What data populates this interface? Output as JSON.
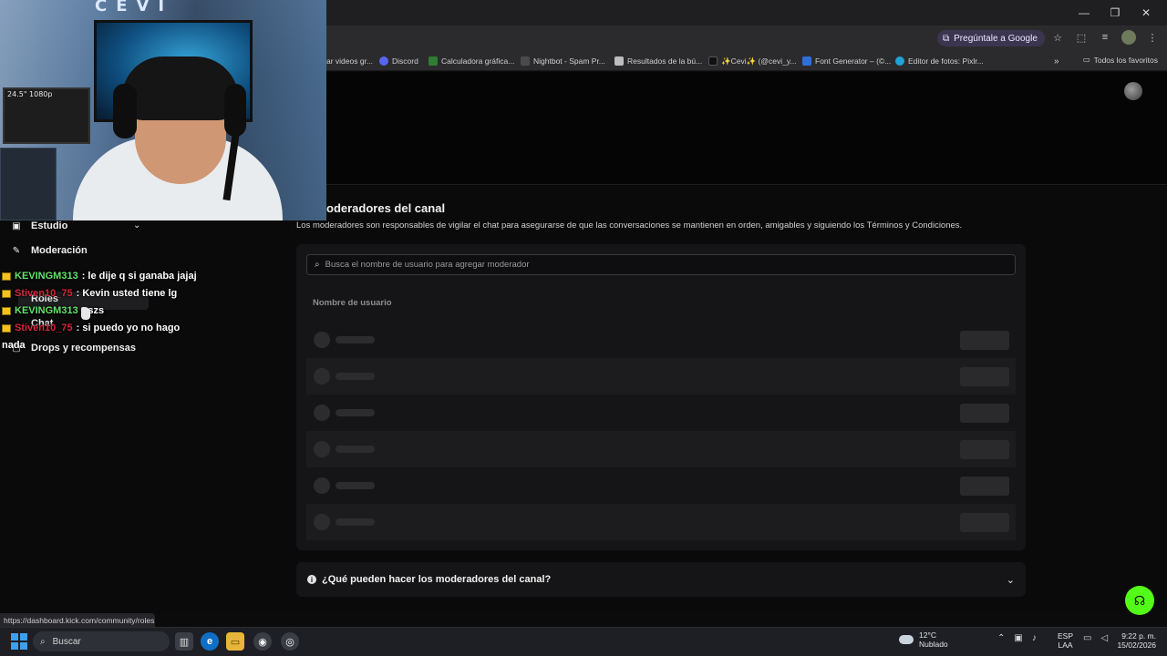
{
  "browser": {
    "ask_google_label": "Pregúntale a Google",
    "bookmarks": [
      {
        "label": "ar videos gr...",
        "icon": "video-favicon",
        "color": "#cc3333"
      },
      {
        "label": "Discord",
        "icon": "discord-favicon",
        "color": "#5865f2"
      },
      {
        "label": "Calculadora gráfica...",
        "icon": "desmos-favicon",
        "color": "#2e7d32"
      },
      {
        "label": "Nightbot - Spam Pr...",
        "icon": "nightbot-favicon",
        "color": "#4a4a4a"
      },
      {
        "label": "Resultados de la bú...",
        "icon": "doc-favicon",
        "color": "#bdbdbd"
      },
      {
        "label": "✨Cevi✨ (@cevi_y...",
        "icon": "tiktok-favicon",
        "color": "#111111"
      },
      {
        "label": "Font Generator – (©...",
        "icon": "font-favicon",
        "color": "#2f6fdc"
      },
      {
        "label": "Editor de fotos: Pixlr...",
        "icon": "pixlr-favicon",
        "color": "#1fa3d6"
      }
    ],
    "all_bookmarks_label": "Todos los favoritos"
  },
  "sidebar": {
    "studio_label": "Estudio",
    "moderation_label": "Moderación",
    "roles_label": "Roles",
    "chat_label": "Chat",
    "drops_label": "Drops y recompensas"
  },
  "main": {
    "title": "oderadores del canal",
    "description": "Los moderadores son responsables de vigilar el chat para asegurarse de que las conversaciones se mantienen en orden, amigables y siguiendo los Términos y Condiciones.",
    "search_placeholder": "Busca el nombre de usuario para agregar moderador",
    "column_username": "Nombre de usuario",
    "faq_label": "¿Qué pueden hacer los moderadores del canal?"
  },
  "stream_chat": [
    {
      "user": "KEVINGM313",
      "user_color": "#64e36a",
      "message": ": le dije q si ganaba jajaj"
    },
    {
      "user": "Stiven10_75",
      "user_color": "#d8263a",
      "message": ": Kevin usted tiene lg"
    },
    {
      "user": "KEVINGM313",
      "user_color": "#64e36a",
      "message": ": szs"
    },
    {
      "user": "Stiven10_75",
      "user_color": "#d8263a",
      "message": ": si puedo yo no hago"
    }
  ],
  "stream_chat_wrap": "nada",
  "webcam": {
    "logo_text": "CEVI",
    "monitor_text": "24.5\" 1080p"
  },
  "status_url": "https://dashboard.kick.com/community/roles",
  "taskbar": {
    "search_label": "Buscar",
    "temperature": "12°C",
    "weather": "Nublado",
    "lang_top": "ESP",
    "lang_bottom": "LAA",
    "time": "9:22 p. m.",
    "date": "15/02/2026"
  },
  "colors": {
    "accent": "#53fc18",
    "background": "#0a0a0b"
  }
}
